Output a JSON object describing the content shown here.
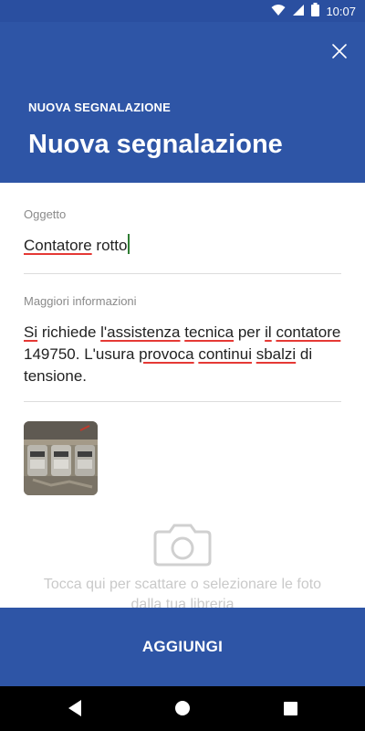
{
  "status_bar": {
    "time": "10:07",
    "icons": [
      "wifi-icon",
      "signal-icon",
      "battery-icon"
    ]
  },
  "header": {
    "overline": "NUOVA SEGNALAZIONE",
    "title": "Nuova segnalazione",
    "close_icon": "close-icon"
  },
  "form": {
    "subject": {
      "label": "Oggetto",
      "value": "Contatore rotto"
    },
    "details": {
      "label": "Maggiori informazioni",
      "value": "Si richiede l'assistenza tecnica per il contatore 149750. L'usura provoca continui sbalzi di tensione."
    }
  },
  "photos": {
    "count": 1,
    "hint": "Tocca qui per scattare o selezionare le foto dalla tua libreria",
    "camera_icon": "camera-icon"
  },
  "actions": {
    "add_label": "AGGIUNGI"
  },
  "nav_bar": {
    "icons": [
      "back-icon",
      "home-icon",
      "recents-icon"
    ]
  },
  "colors": {
    "primary": "#2e55a6",
    "status_bar": "#2a4fa0",
    "spellcheck": "#e53935",
    "caret": "#2e7d32"
  }
}
